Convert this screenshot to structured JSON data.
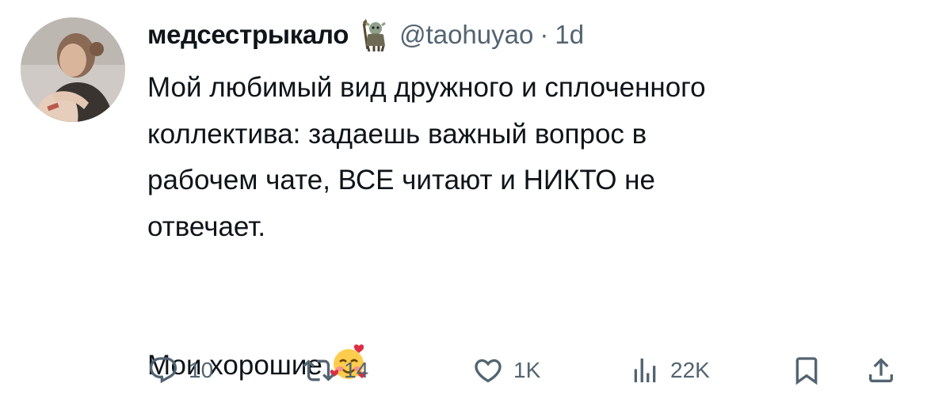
{
  "tweet": {
    "author": {
      "display_name": "медсестрыкало",
      "handle": "@taohuyao",
      "badge_icon": "troll-figure-icon"
    },
    "separator": "·",
    "time": "1d",
    "text_lines": [
      "Мой любимый вид дружного и сплоченного",
      "коллектива: задаешь важный вопрос в",
      "рабочем чате, ВСЕ читают и НИКТО не",
      "отвечает."
    ],
    "closing_text": "Мои хорошие",
    "closing_emoji": "smiling-face-with-hearts-icon"
  },
  "actions": {
    "reply_count": "10",
    "retweet_count": "14",
    "like_count": "1K",
    "views_count": "22K"
  },
  "colors": {
    "text": "#0f1419",
    "secondary": "#536471",
    "background": "#ffffff"
  }
}
